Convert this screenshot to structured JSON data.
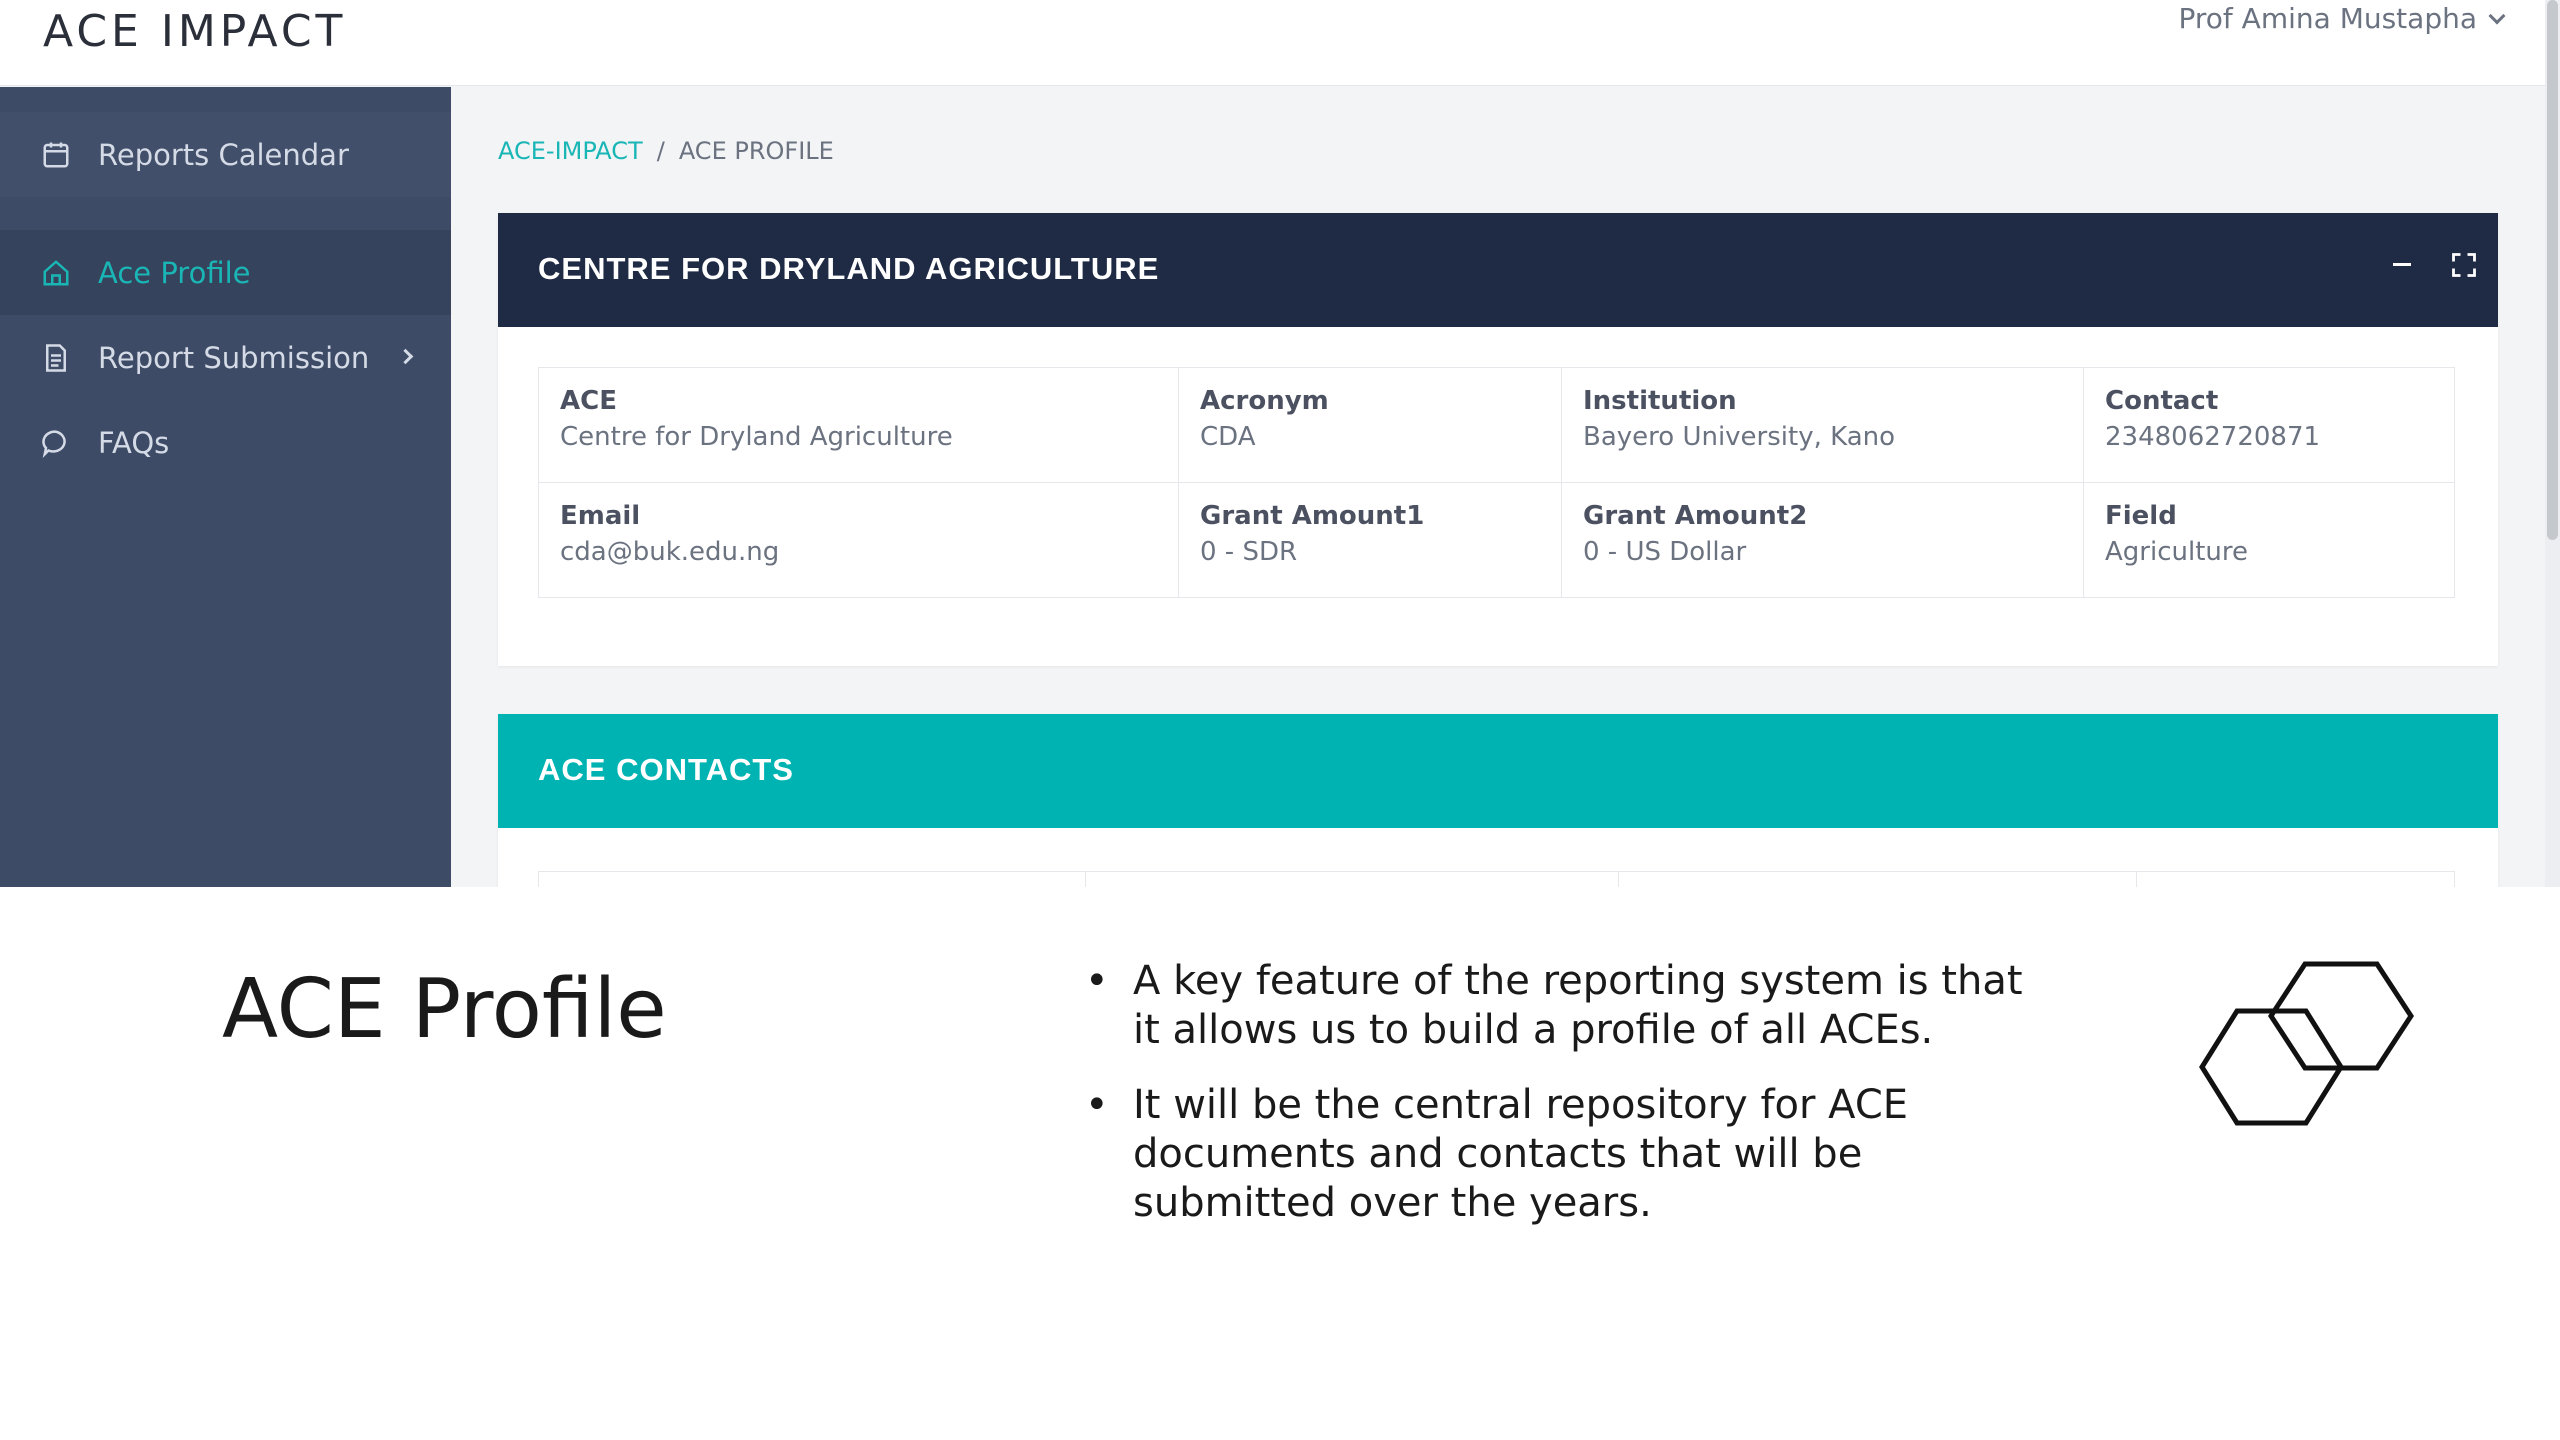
{
  "header": {
    "logo_text": "ACE IMPACT",
    "user_name": "Prof Amina Mustapha"
  },
  "sidebar": {
    "items": [
      {
        "label": "Reports Calendar",
        "icon": "calendar-icon"
      },
      {
        "label": "Ace Profile",
        "icon": "home-icon",
        "active": true
      },
      {
        "label": "Report Submission",
        "icon": "document-icon",
        "has_submenu": true
      },
      {
        "label": "FAQs",
        "icon": "chat-bubble-icon"
      }
    ]
  },
  "breadcrumb": {
    "link": "ACE-IMPACT",
    "separator": "/",
    "current": "ACE PROFILE"
  },
  "profile_card": {
    "title": "CENTRE FOR DRYLAND AGRICULTURE",
    "rows": [
      [
        {
          "label": "ACE",
          "value": "Centre for Dryland Agriculture"
        },
        {
          "label": "Acronym",
          "value": "CDA"
        },
        {
          "label": "Institution",
          "value": "Bayero University, Kano"
        },
        {
          "label": "Contact",
          "value": "2348062720871"
        }
      ],
      [
        {
          "label": "Email",
          "value": "cda@buk.edu.ng"
        },
        {
          "label": "Grant Amount1",
          "value": "0 - SDR"
        },
        {
          "label": "Grant Amount2",
          "value": "0 - US Dollar"
        },
        {
          "label": "Field",
          "value": "Agriculture"
        }
      ]
    ]
  },
  "contacts_card": {
    "title": "ACE CONTACTS"
  },
  "slide": {
    "title": "ACE Profile",
    "bullets": [
      "A key feature of the reporting system is that it allows us to build a profile of all ACEs.",
      "It will be the central repository for ACE documents and contacts that will be submitted over the years."
    ]
  },
  "colors": {
    "sidebar_bg": "#3d4b66",
    "accent_teal": "#19b6b5",
    "card_header_dark": "#1f2a44",
    "contacts_header": "#00b3b3"
  }
}
